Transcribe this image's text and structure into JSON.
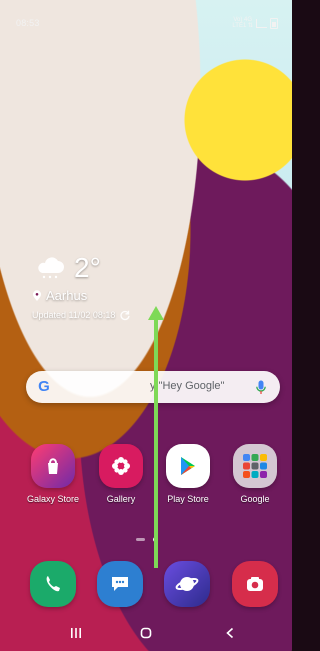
{
  "statusbar": {
    "time": "08:53",
    "network_label_1": "Vo) 4G",
    "network_label_2": "LTE1 ⇅"
  },
  "weather": {
    "temperature": "2°",
    "location": "Aarhus",
    "updated": "Updated 11/02 08:18",
    "icon": "cloud-snow-icon"
  },
  "search": {
    "text": "y \"Hey Google\"",
    "left_icon": "google-g-icon",
    "right_icon": "mic-icon"
  },
  "apps": [
    {
      "label": "Galaxy Store",
      "icon": "shopping-bag-icon"
    },
    {
      "label": "Gallery",
      "icon": "flower-icon"
    },
    {
      "label": "Play Store",
      "icon": "play-store-icon"
    },
    {
      "label": "Google",
      "icon": "google-folder-icon"
    }
  ],
  "dock": [
    {
      "icon": "phone-icon"
    },
    {
      "icon": "messages-icon"
    },
    {
      "icon": "internet-icon"
    },
    {
      "icon": "camera-icon"
    }
  ],
  "navbar": {
    "recents": "recents-icon",
    "home": "home-icon",
    "back": "back-icon"
  },
  "colors": {
    "gesture_arrow": "#7ED957",
    "search_bg": "#FFFFFF",
    "galaxy_store": "#7B3FA0",
    "gallery": "#D81B60",
    "phone": "#1BAA6A",
    "messages": "#2D7FD1",
    "internet": "#4B3FB3",
    "camera": "#D62D4B"
  }
}
